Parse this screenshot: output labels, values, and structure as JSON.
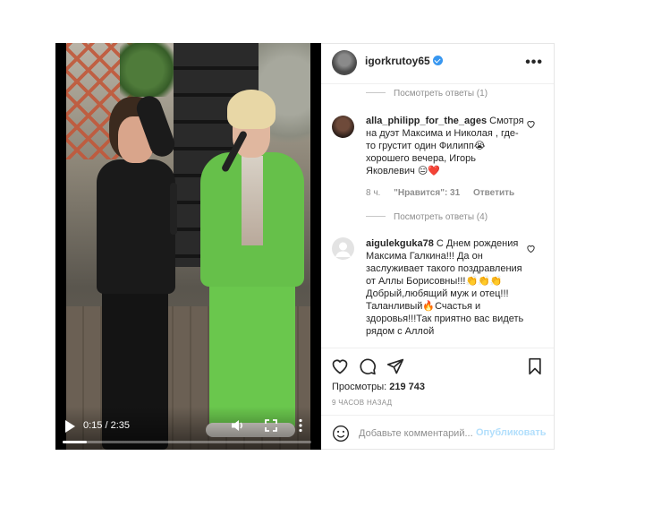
{
  "video": {
    "time": "0:15 / 2:35",
    "progress": 0.097
  },
  "header": {
    "username": "igorkrutoy65",
    "more_icon": "more-horizontal-icon"
  },
  "comments": {
    "replies_1": "Посмотреть ответы (1)",
    "comment_1": {
      "user": "alla_philipp_for_the_ages",
      "text": " Смотря на дуэт Максима и Николая , где-то грустит один Филипп😭 хорошего вечера, Игорь Яковлевич 😑❤️",
      "age": "8 ч.",
      "likes": "\"Нравится\": 31",
      "reply": "Ответить"
    },
    "replies_2": "Посмотреть ответы (4)",
    "comment_2": {
      "user": "aigulekguka78",
      "text": " С Днем рождения Максима Галкина!!! Да он заслуживает такого поздравления от Аллы Борисовны!!!👏👏👏 Добрый,любящий муж и отец!!! Таланливый🔥Счастья и здоровья!!!Так приятно вас видеть рядом с Аллой"
    }
  },
  "stats": {
    "views_label": "Просмотры:",
    "views_value": "219 743",
    "time_ago": "9 ЧАСОВ НАЗАД"
  },
  "comment_box": {
    "placeholder": "Добавьте комментарий...",
    "publish": "Опубликовать"
  },
  "colors": {
    "accent": "#3897f0",
    "publish_disabled": "#b2dffc",
    "heart": "#ed4956"
  }
}
